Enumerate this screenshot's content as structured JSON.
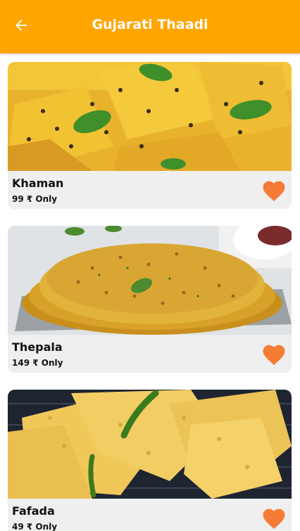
{
  "app_bar": {
    "title": "Gujarati Thaadi",
    "back_icon": "arrow-left-icon",
    "background": "#ffa500"
  },
  "items": [
    {
      "name": "Khaman",
      "price": "99 ₹ Only",
      "image": "khaman-photo",
      "favorite_icon": "heart-icon"
    },
    {
      "name": "Thepala",
      "price": "149 ₹ Only",
      "image": "thepala-photo",
      "favorite_icon": "heart-icon"
    },
    {
      "name": "Fafada",
      "price": "49 ₹ Only",
      "image": "fafada-photo",
      "favorite_icon": "heart-icon"
    }
  ],
  "colors": {
    "accent": "#ffa500",
    "heart": "#f57c35"
  }
}
